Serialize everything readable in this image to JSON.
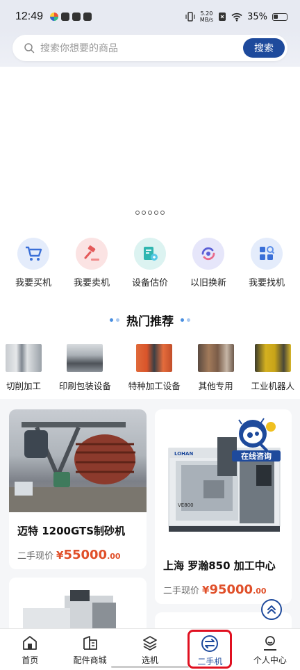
{
  "status_bar": {
    "time": "12:49",
    "net_speed_value": "5.20",
    "net_speed_unit": "MB/s",
    "battery": "35%"
  },
  "search": {
    "placeholder": "搜索你想要的商品",
    "button_label": "搜索"
  },
  "banner": {
    "dot_count": 5
  },
  "quick_nav": [
    {
      "label": "我要买机",
      "icon": "shopping-cart-icon",
      "color": "#3a6fd8"
    },
    {
      "label": "我要卖机",
      "icon": "auction-hammer-icon",
      "color": "#e45a5a"
    },
    {
      "label": "设备估价",
      "icon": "valuation-icon",
      "color": "#2fb6b0"
    },
    {
      "label": "以旧换新",
      "icon": "trade-in-icon",
      "color": "#5b5fd6"
    },
    {
      "label": "我要找机",
      "icon": "find-machine-icon",
      "color": "#3a6fd8"
    }
  ],
  "hot": {
    "title": "热门推荐",
    "categories": [
      {
        "label": "切削加工"
      },
      {
        "label": "印刷包装设备"
      },
      {
        "label": "特种加工设备"
      },
      {
        "label": "其他专用"
      },
      {
        "label": "工业机器人"
      }
    ]
  },
  "products": [
    {
      "title": "迈特 1200GTS制砂机",
      "price_label": "二手现价",
      "currency": "¥",
      "price_int": "55000",
      "price_dec": ".00"
    },
    {
      "title": "上海 罗瀚850 加工中心",
      "price_label": "二手现价",
      "currency": "¥",
      "price_int": "95000",
      "price_dec": ".00",
      "badge": "在线咨询",
      "machine_brand": "LOHAN",
      "machine_model": "VE800"
    }
  ],
  "tab_bar": [
    {
      "label": "首页",
      "icon": "home-icon"
    },
    {
      "label": "配件商城",
      "icon": "store-icon"
    },
    {
      "label": "选机",
      "icon": "layers-icon"
    },
    {
      "label": "二手机",
      "icon": "exchange-icon",
      "active": true
    },
    {
      "label": "个人中心",
      "icon": "user-icon"
    }
  ],
  "colors": {
    "brand": "#1e4a9c",
    "price": "#e0502a",
    "highlight": "#e01020"
  }
}
